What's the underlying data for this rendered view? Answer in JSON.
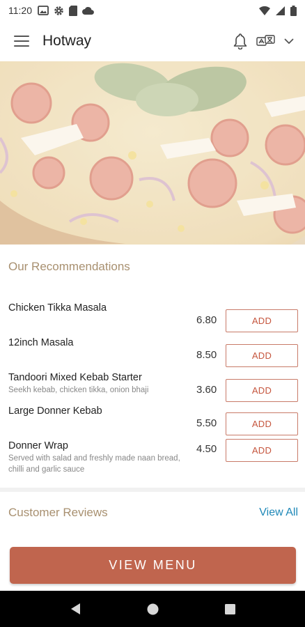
{
  "status_bar": {
    "time": "11:20"
  },
  "app_bar": {
    "title": "Hotway"
  },
  "recommendations": {
    "title": "Our Recommendations",
    "items": [
      {
        "name": "Chicken Tikka Masala",
        "description": "",
        "price": "6.80",
        "button_label": "ADD"
      },
      {
        "name": "12inch Masala",
        "description": "",
        "price": "8.50",
        "button_label": "ADD"
      },
      {
        "name": "Tandoori Mixed Kebab Starter",
        "description": "Seekh kebab, chicken tikka, onion bhaji",
        "price": "3.60",
        "button_label": "ADD"
      },
      {
        "name": "Large Donner Kebab",
        "description": "",
        "price": "5.50",
        "button_label": "ADD"
      },
      {
        "name": "Donner Wrap",
        "description": "Served with salad and freshly made naan bread, chilli and garlic sauce",
        "price": "4.50",
        "button_label": "ADD"
      }
    ]
  },
  "reviews": {
    "title": "Customer Reviews",
    "view_all_label": "View All"
  },
  "view_menu": {
    "label": "VIEW MENU"
  },
  "colors": {
    "accent": "#c0654e",
    "section_title": "#a89070",
    "link": "#1e88b8"
  },
  "icons": {
    "status_left": [
      "image-icon",
      "gear-icon",
      "sd-card-icon",
      "cloud-icon"
    ],
    "status_right": [
      "wifi-icon",
      "signal-icon",
      "battery-icon"
    ],
    "app_bar": [
      "menu-icon",
      "bell-icon",
      "language-icon",
      "chevron-down-icon"
    ],
    "nav": [
      "back-icon",
      "home-icon",
      "recents-icon"
    ]
  }
}
